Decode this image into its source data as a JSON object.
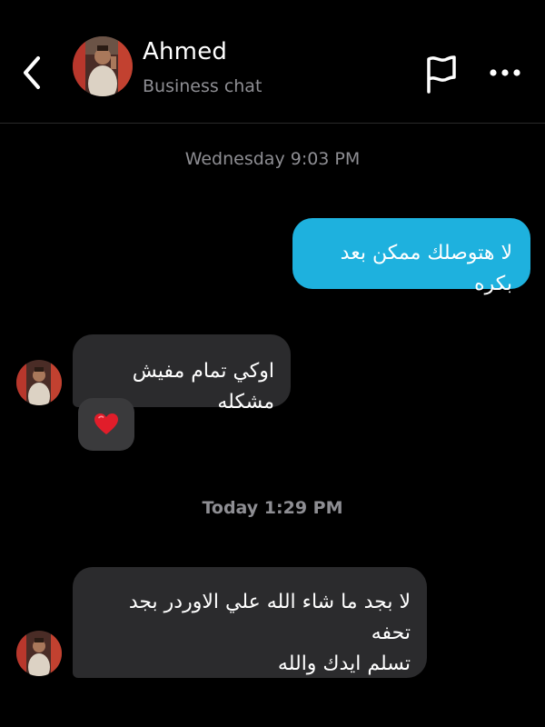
{
  "header": {
    "name": "Ahmed",
    "subtitle": "Business chat"
  },
  "icons": {
    "back": "chevron-left-icon",
    "flag": "flag-icon",
    "more": "more-horizontal-icon",
    "heart": "heart-icon"
  },
  "colors": {
    "background": "#000000",
    "outgoing_bubble": "#1eb1de",
    "incoming_bubble": "#2b2b2d",
    "heart": "#e11d2a",
    "secondary_text": "#8e8e93"
  },
  "messages": {
    "ts1": "Wednesday 9:03 PM",
    "out1": "لا هتوصلك ممكن بعد بكره",
    "in1": "اوكي تمام مفيش مشكله",
    "reaction": "❤️",
    "ts2": "Today 1:29 PM",
    "in2_line1": "لا بجد ما شاء الله علي الاوردر بجد تحفه",
    "in2_line2": "تسلم ايدك والله"
  }
}
